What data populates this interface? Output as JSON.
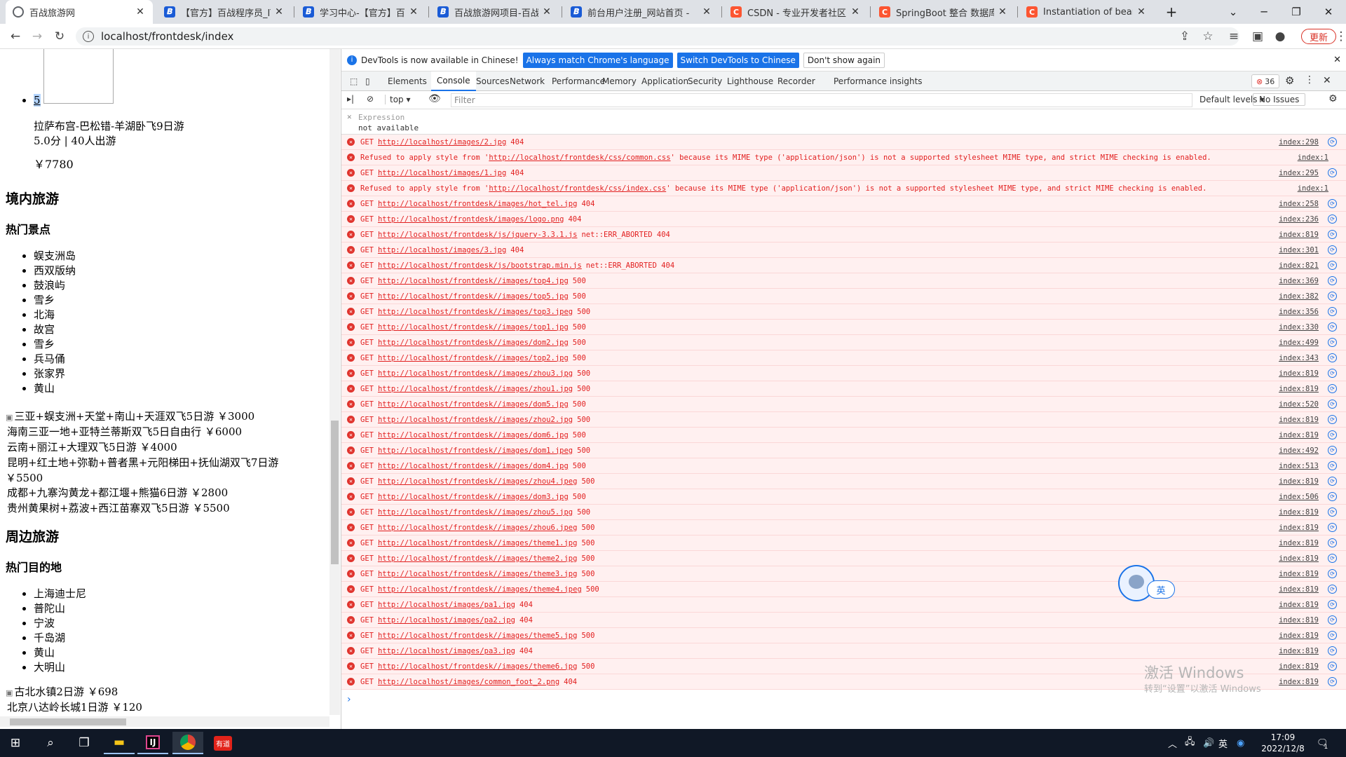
{
  "browser": {
    "tabs": [
      {
        "title": "百战旅游网",
        "icon": "globe-icon",
        "color": "#5f6368",
        "active": true
      },
      {
        "title": "【官方】百战程序员_IT在线",
        "icon": "document-icon",
        "color": "#1a5bd6"
      },
      {
        "title": "学习中心-【官方】百战程序",
        "icon": "document-icon",
        "color": "#1a5bd6"
      },
      {
        "title": "百战旅游网项目-百战程序员",
        "icon": "document-icon",
        "color": "#1a5bd6"
      },
      {
        "title": "前台用户注册_网站首页 - ",
        "icon": "document-icon",
        "color": "#1a5bd6"
      },
      {
        "title": "CSDN - 专业开发者社区",
        "icon": "csdn-icon",
        "color": "#fc5531"
      },
      {
        "title": "SpringBoot 整合 数据库连接",
        "icon": "csdn-icon",
        "color": "#fc5531"
      },
      {
        "title": "Instantiation of bean failed",
        "icon": "csdn-icon",
        "color": "#fc5531"
      }
    ],
    "address": "localhost/frontdesk/index",
    "update_label": "更新"
  },
  "page": {
    "selected_item": "5",
    "tour": {
      "name": "拉萨布宫-巴松错-羊湖卧飞9日游",
      "rating_people": "5.0分 | 40人出游",
      "price": "￥7780"
    },
    "domestic": {
      "heading": "境内旅游",
      "subheading": "热门景点",
      "spots": [
        "蜈支洲岛",
        "西双版纳",
        "鼓浪屿",
        "雪乡",
        "北海",
        "故宫",
        "雪乡",
        "兵马俑",
        "张家界",
        "黄山"
      ],
      "products": [
        "三亚+蜈支洲+天堂+南山+天涯双飞5日游 ￥3000",
        "海南三亚一地+亚特兰蒂斯双飞5日自由行 ￥6000",
        "云南+丽江+大理双飞5日游 ￥4000",
        "昆明+红土地+弥勒+普者黑+元阳梯田+抚仙湖双飞7日游",
        "￥5500",
        "成都+九寨沟黄龙+都江堰+熊猫6日游 ￥2800",
        "贵州黄果树+荔波+西江苗寨双飞5日游 ￥5500"
      ]
    },
    "nearby": {
      "heading": "周边旅游",
      "subheading": "热门目的地",
      "spots": [
        "上海迪士尼",
        "普陀山",
        "宁波",
        "千岛湖",
        "黄山",
        "大明山"
      ],
      "products": [
        "古北水镇2日游 ￥698",
        "北京八达岭长城1日游 ￥120"
      ]
    }
  },
  "devtools": {
    "infobar": {
      "message": "DevTools is now available in Chinese!",
      "btn1": "Always match Chrome's language",
      "btn2": "Switch DevTools to Chinese",
      "btn3": "Don't show again"
    },
    "tabs": [
      "Elements",
      "Console",
      "Sources",
      "Network",
      "Performance",
      "Memory",
      "Application",
      "Security",
      "Lighthouse",
      "Recorder",
      "Performance insights"
    ],
    "active_tab": "Console",
    "error_count": "36",
    "context": "top",
    "filter_placeholder": "Filter",
    "levels": "Default levels",
    "issues": "No Issues",
    "expression": {
      "label": "Expression",
      "value": "not available"
    },
    "logs": [
      {
        "prefix": "GET",
        "url": "http://localhost/images/2.jpg",
        "suffix": "404",
        "src": "index:298"
      },
      {
        "prefix": "Refused to apply style from '",
        "url": "http://localhost/frontdesk/css/common.css",
        "suffix": "' because its MIME type ('application/json') is not a supported stylesheet MIME type, and strict MIME checking is enabled.",
        "src": "index:1",
        "noicon": true
      },
      {
        "prefix": "GET",
        "url": "http://localhost/images/1.jpg",
        "suffix": "404",
        "src": "index:295"
      },
      {
        "prefix": "Refused to apply style from '",
        "url": "http://localhost/frontdesk/css/index.css",
        "suffix": "' because its MIME type ('application/json') is not a supported stylesheet MIME type, and strict MIME checking is enabled.",
        "src": "index:1",
        "noicon": true
      },
      {
        "prefix": "GET",
        "url": "http://localhost/frontdesk/images/hot_tel.jpg",
        "suffix": "404",
        "src": "index:258"
      },
      {
        "prefix": "GET",
        "url": "http://localhost/frontdesk/images/logo.png",
        "suffix": "404",
        "src": "index:236"
      },
      {
        "prefix": "GET",
        "url": "http://localhost/frontdesk/js/jquery-3.3.1.js",
        "suffix": "net::ERR_ABORTED 404",
        "src": "index:819"
      },
      {
        "prefix": "GET",
        "url": "http://localhost/images/3.jpg",
        "suffix": "404",
        "src": "index:301"
      },
      {
        "prefix": "GET",
        "url": "http://localhost/frontdesk/js/bootstrap.min.js",
        "suffix": "net::ERR_ABORTED 404",
        "src": "index:821"
      },
      {
        "prefix": "GET",
        "url": "http://localhost/frontdesk//images/top4.jpg",
        "suffix": "500",
        "src": "index:369"
      },
      {
        "prefix": "GET",
        "url": "http://localhost/frontdesk//images/top5.jpg",
        "suffix": "500",
        "src": "index:382"
      },
      {
        "prefix": "GET",
        "url": "http://localhost/frontdesk//images/top3.jpeg",
        "suffix": "500",
        "src": "index:356"
      },
      {
        "prefix": "GET",
        "url": "http://localhost/frontdesk//images/top1.jpg",
        "suffix": "500",
        "src": "index:330"
      },
      {
        "prefix": "GET",
        "url": "http://localhost/frontdesk//images/dom2.jpg",
        "suffix": "500",
        "src": "index:499"
      },
      {
        "prefix": "GET",
        "url": "http://localhost/frontdesk//images/top2.jpg",
        "suffix": "500",
        "src": "index:343"
      },
      {
        "prefix": "GET",
        "url": "http://localhost/frontdesk//images/zhou3.jpg",
        "suffix": "500",
        "src": "index:819"
      },
      {
        "prefix": "GET",
        "url": "http://localhost/frontdesk//images/zhou1.jpg",
        "suffix": "500",
        "src": "index:819"
      },
      {
        "prefix": "GET",
        "url": "http://localhost/frontdesk//images/dom5.jpg",
        "suffix": "500",
        "src": "index:520"
      },
      {
        "prefix": "GET",
        "url": "http://localhost/frontdesk//images/zhou2.jpg",
        "suffix": "500",
        "src": "index:819"
      },
      {
        "prefix": "GET",
        "url": "http://localhost/frontdesk//images/dom6.jpg",
        "suffix": "500",
        "src": "index:819"
      },
      {
        "prefix": "GET",
        "url": "http://localhost/frontdesk//images/dom1.jpeg",
        "suffix": "500",
        "src": "index:492"
      },
      {
        "prefix": "GET",
        "url": "http://localhost/frontdesk//images/dom4.jpg",
        "suffix": "500",
        "src": "index:513"
      },
      {
        "prefix": "GET",
        "url": "http://localhost/frontdesk//images/zhou4.jpeg",
        "suffix": "500",
        "src": "index:819"
      },
      {
        "prefix": "GET",
        "url": "http://localhost/frontdesk//images/dom3.jpg",
        "suffix": "500",
        "src": "index:506"
      },
      {
        "prefix": "GET",
        "url": "http://localhost/frontdesk//images/zhou5.jpg",
        "suffix": "500",
        "src": "index:819"
      },
      {
        "prefix": "GET",
        "url": "http://localhost/frontdesk//images/zhou6.jpeg",
        "suffix": "500",
        "src": "index:819"
      },
      {
        "prefix": "GET",
        "url": "http://localhost/frontdesk//images/theme1.jpg",
        "suffix": "500",
        "src": "index:819"
      },
      {
        "prefix": "GET",
        "url": "http://localhost/frontdesk//images/theme2.jpg",
        "suffix": "500",
        "src": "index:819"
      },
      {
        "prefix": "GET",
        "url": "http://localhost/frontdesk//images/theme3.jpg",
        "suffix": "500",
        "src": "index:819"
      },
      {
        "prefix": "GET",
        "url": "http://localhost/frontdesk//images/theme4.jpeg",
        "suffix": "500",
        "src": "index:819"
      },
      {
        "prefix": "GET",
        "url": "http://localhost/images/pa1.jpg",
        "suffix": "404",
        "src": "index:819"
      },
      {
        "prefix": "GET",
        "url": "http://localhost/images/pa2.jpg",
        "suffix": "404",
        "src": "index:819"
      },
      {
        "prefix": "GET",
        "url": "http://localhost/frontdesk//images/theme5.jpg",
        "suffix": "500",
        "src": "index:819"
      },
      {
        "prefix": "GET",
        "url": "http://localhost/images/pa3.jpg",
        "suffix": "404",
        "src": "index:819"
      },
      {
        "prefix": "GET",
        "url": "http://localhost/frontdesk//images/theme6.jpg",
        "suffix": "500",
        "src": "index:819"
      },
      {
        "prefix": "GET",
        "url": "http://localhost/images/common_foot_2.png",
        "suffix": "404",
        "src": "index:819"
      }
    ]
  },
  "overlay": {
    "ime_lang": "英",
    "activate_title": "激活 Windows",
    "activate_sub": "转到“设置”以激活 Windows"
  },
  "taskbar": {
    "time": "17:09",
    "date": "2022/12/8",
    "ime": "英",
    "notify_count": "1"
  },
  "colors": {
    "error_text": "#e21f1f",
    "error_bg": "#fff0f0",
    "accent": "#1a73e8",
    "taskbar": "#101826"
  }
}
